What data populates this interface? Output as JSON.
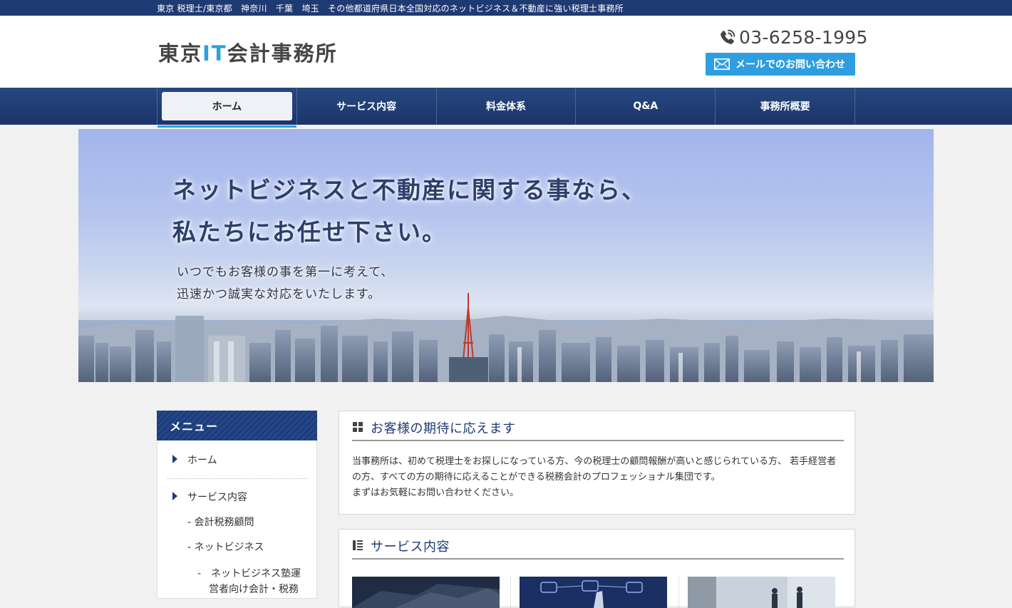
{
  "topbar": {
    "text": "東京 税理士/東京都　神奈川　千葉　埼玉　その他都道府県日本全国対応のネットビジネス＆不動産に強い税理士事務所"
  },
  "header": {
    "logo_pre": "東京",
    "logo_it": "IT",
    "logo_post": "会計事務所",
    "phone": "03-6258-1995",
    "mail_label": "メールでのお問い合わせ",
    "icons": [
      "phone-icon",
      "mail-icon"
    ]
  },
  "nav": {
    "items": [
      {
        "label": "ホーム",
        "active": true
      },
      {
        "label": "サービス内容"
      },
      {
        "label": "料金体系"
      },
      {
        "label": "Q&A"
      },
      {
        "label": "事務所概要"
      }
    ]
  },
  "hero": {
    "title_line1": "ネットビジネスと不動産に関する事なら、",
    "title_line2": "私たちにお任せ下さい。",
    "sub_line1": "いつでもお客様の事を第一に考えて、",
    "sub_line2": "迅速かつ誠実な対応をいたします。"
  },
  "sidebar": {
    "heading": "メニュー",
    "items": [
      {
        "label": "ホーム"
      },
      {
        "label": "サービス内容"
      },
      {
        "label": "- 会計税務顧問"
      },
      {
        "label": "- ネットビジネス"
      },
      {
        "label": "-　ネットビジネス塾運"
      },
      {
        "label": "営者向け会計・税務"
      }
    ]
  },
  "main": {
    "intro": {
      "title": "お客様の期待に応えます",
      "line1": "当事務所は、初めて税理士をお探しになっている方、今の税理士の顧問報酬が高いと感じられている方、 若手経営者",
      "line2": "の方、すべての方の期待に応えることができる税務会計のプロフェッショナル集団です。",
      "line3": "まずはお気軽にお問い合わせください。"
    },
    "services": {
      "title": "サービス内容"
    }
  },
  "colors": {
    "navy": "#1e3a73",
    "accent": "#2aa1dd",
    "mail_button": "#2e9ee0"
  }
}
